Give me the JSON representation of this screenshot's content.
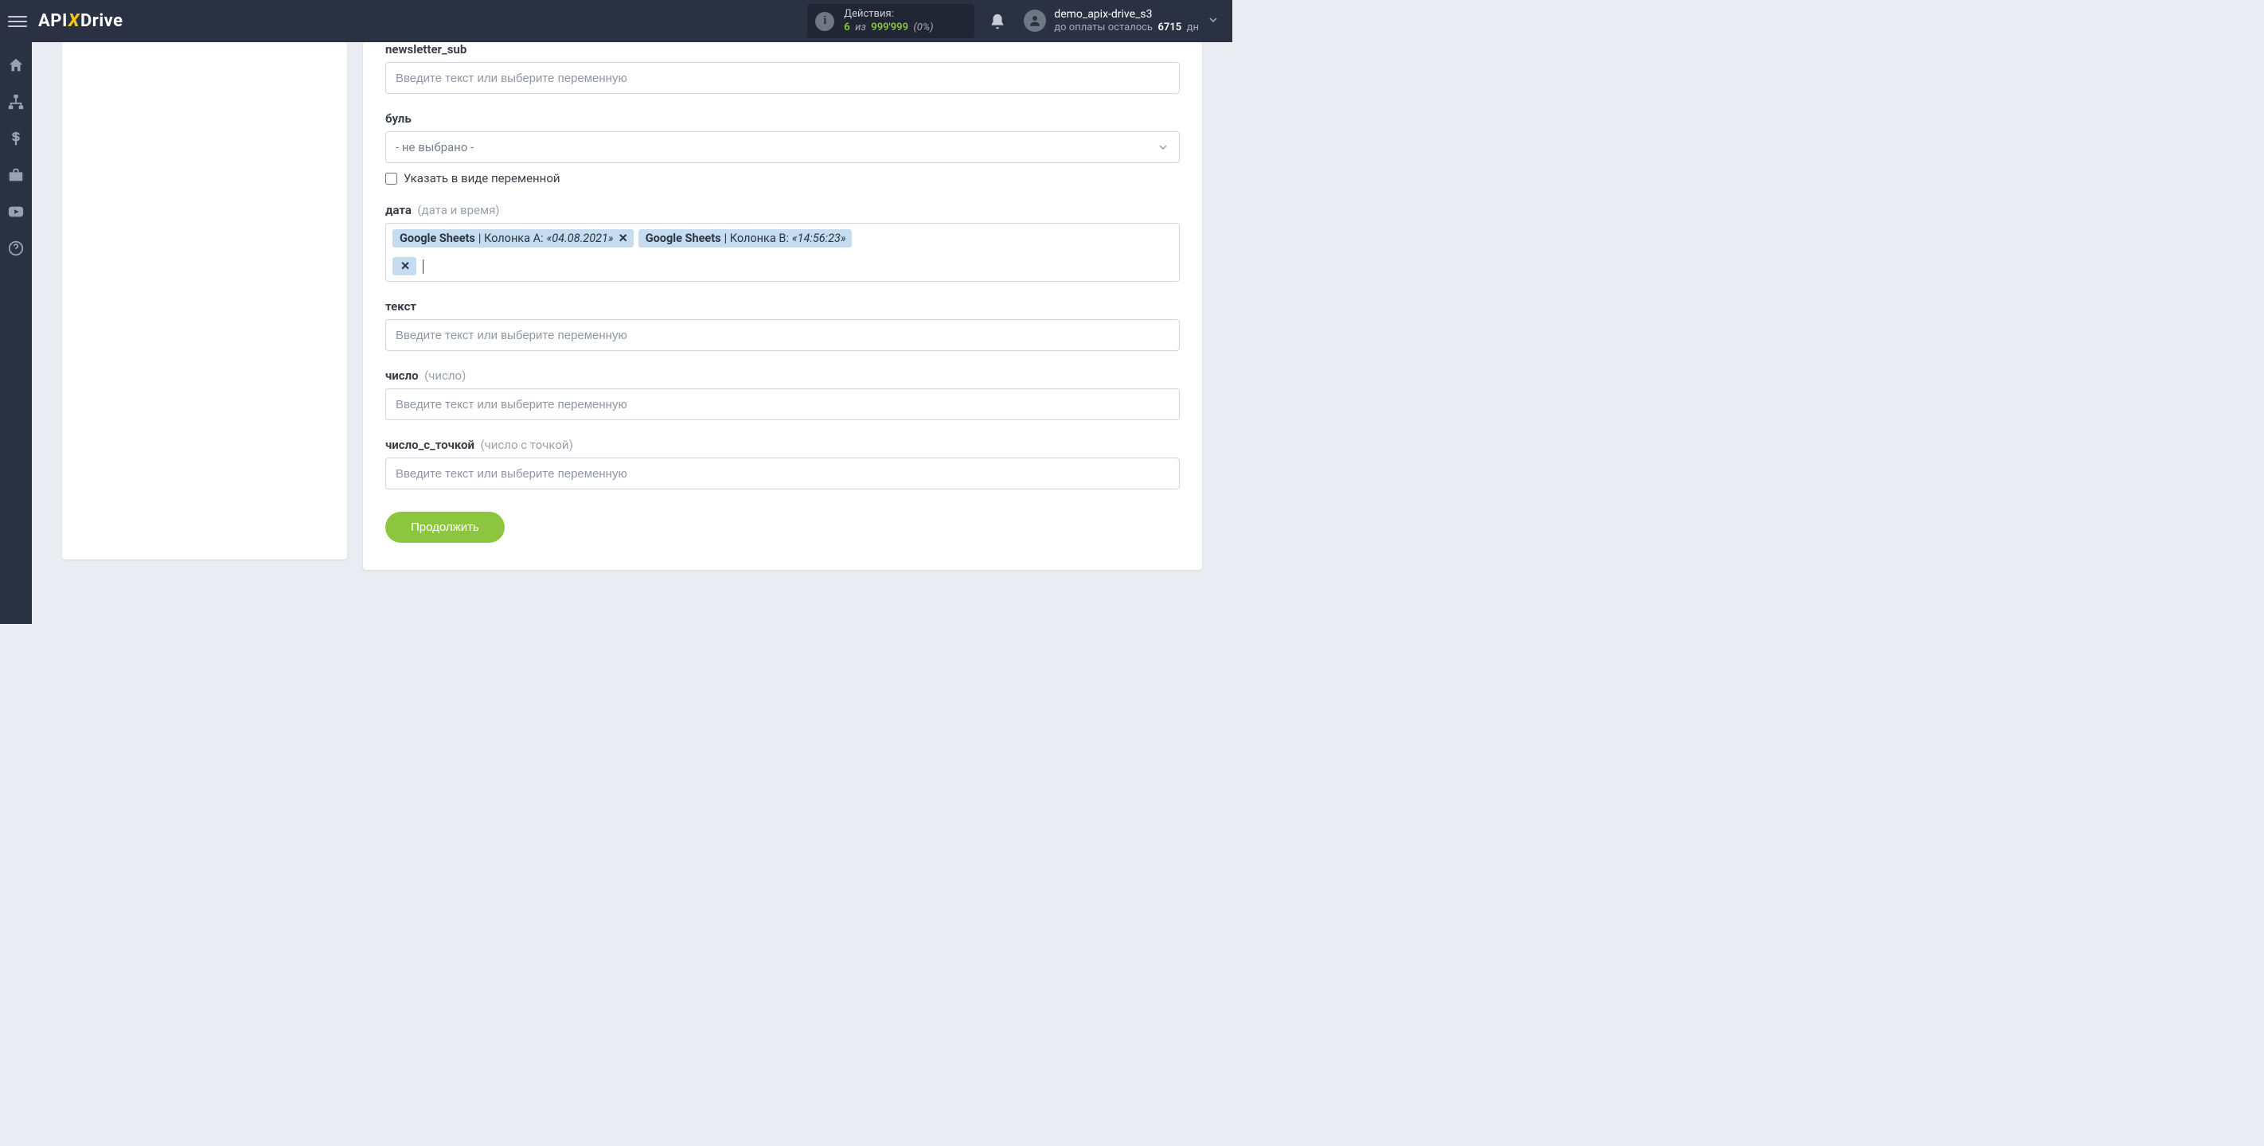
{
  "header": {
    "logo_api": "API",
    "logo_x": "X",
    "logo_drive": "Drive",
    "actions_label": "Действия:",
    "actions_count": "6",
    "actions_of": "из",
    "actions_limit": "999'999",
    "actions_pct": "(0%)",
    "user_name": "demo_apix-drive_s3",
    "user_pay_prefix": "до оплаты осталось",
    "user_pay_days": "6715",
    "user_pay_suffix": "дн"
  },
  "leftnav": {
    "items": [
      "home",
      "sitemap",
      "dollar",
      "briefcase",
      "youtube",
      "question"
    ]
  },
  "form": {
    "fields": {
      "newsletter_sub": {
        "label": "newsletter_sub",
        "placeholder": "Введите текст или выберите переменную"
      },
      "bool": {
        "label": "буль",
        "placeholder": "- не выбрано -",
        "checkbox_label": "Указать в виде переменной"
      },
      "date": {
        "label": "дата",
        "hint": "(дата и время)",
        "tags": [
          {
            "source": "Google Sheets",
            "column": "Колонка A:",
            "value": "«04.08.2021»",
            "show_remove": true
          },
          {
            "source": "Google Sheets",
            "column": "Колонка B:",
            "value": "«14:56:23»",
            "show_remove": false
          }
        ]
      },
      "text": {
        "label": "текст",
        "placeholder": "Введите текст или выберите переменную"
      },
      "number": {
        "label": "число",
        "hint": "(число)",
        "placeholder": "Введите текст или выберите переменную"
      },
      "number_dot": {
        "label": "число_с_точкой",
        "hint": "(число с точкой)",
        "placeholder": "Введите текст или выберите переменную"
      }
    },
    "submit_label": "Продолжить"
  }
}
